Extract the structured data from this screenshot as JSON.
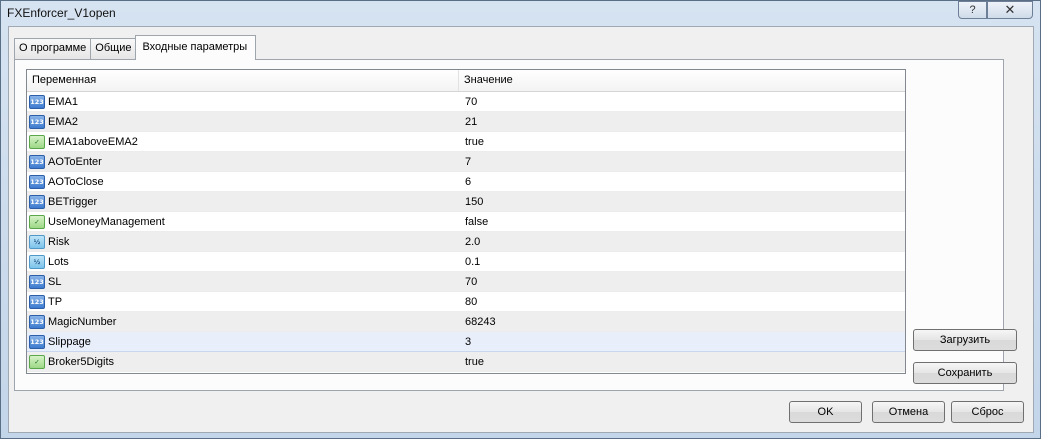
{
  "window": {
    "title": "FXEnforcer_V1open",
    "help_label": "?",
    "close_label": "✕"
  },
  "tabs": [
    {
      "label": "О программе"
    },
    {
      "label": "Общие"
    },
    {
      "label": "Входные параметры"
    }
  ],
  "grid": {
    "headers": {
      "variable": "Переменная",
      "value": "Значение"
    },
    "rows": [
      {
        "type": "int",
        "icon_text": "123",
        "name": "EMA1",
        "value": "70"
      },
      {
        "type": "int",
        "icon_text": "123",
        "name": "EMA2",
        "value": "21"
      },
      {
        "type": "bool",
        "icon_text": "✓",
        "name": "EMA1aboveEMA2",
        "value": "true"
      },
      {
        "type": "int",
        "icon_text": "123",
        "name": "AOToEnter",
        "value": "7"
      },
      {
        "type": "int",
        "icon_text": "123",
        "name": "AOToClose",
        "value": "6"
      },
      {
        "type": "int",
        "icon_text": "123",
        "name": "BETrigger",
        "value": "150"
      },
      {
        "type": "bool",
        "icon_text": "✓",
        "name": "UseMoneyManagement",
        "value": "false"
      },
      {
        "type": "double",
        "icon_text": "½",
        "name": "Risk",
        "value": "2.0"
      },
      {
        "type": "double",
        "icon_text": "½",
        "name": "Lots",
        "value": "0.1"
      },
      {
        "type": "int",
        "icon_text": "123",
        "name": "SL",
        "value": "70"
      },
      {
        "type": "int",
        "icon_text": "123",
        "name": "TP",
        "value": "80"
      },
      {
        "type": "int",
        "icon_text": "123",
        "name": "MagicNumber",
        "value": "68243"
      },
      {
        "type": "int",
        "icon_text": "123",
        "name": "Slippage",
        "value": "3"
      },
      {
        "type": "bool",
        "icon_text": "✓",
        "name": "Broker5Digits",
        "value": "true"
      }
    ]
  },
  "buttons": {
    "load": "Загрузить",
    "save": "Сохранить",
    "ok": "OK",
    "cancel": "Отмена",
    "reset": "Сброс"
  }
}
